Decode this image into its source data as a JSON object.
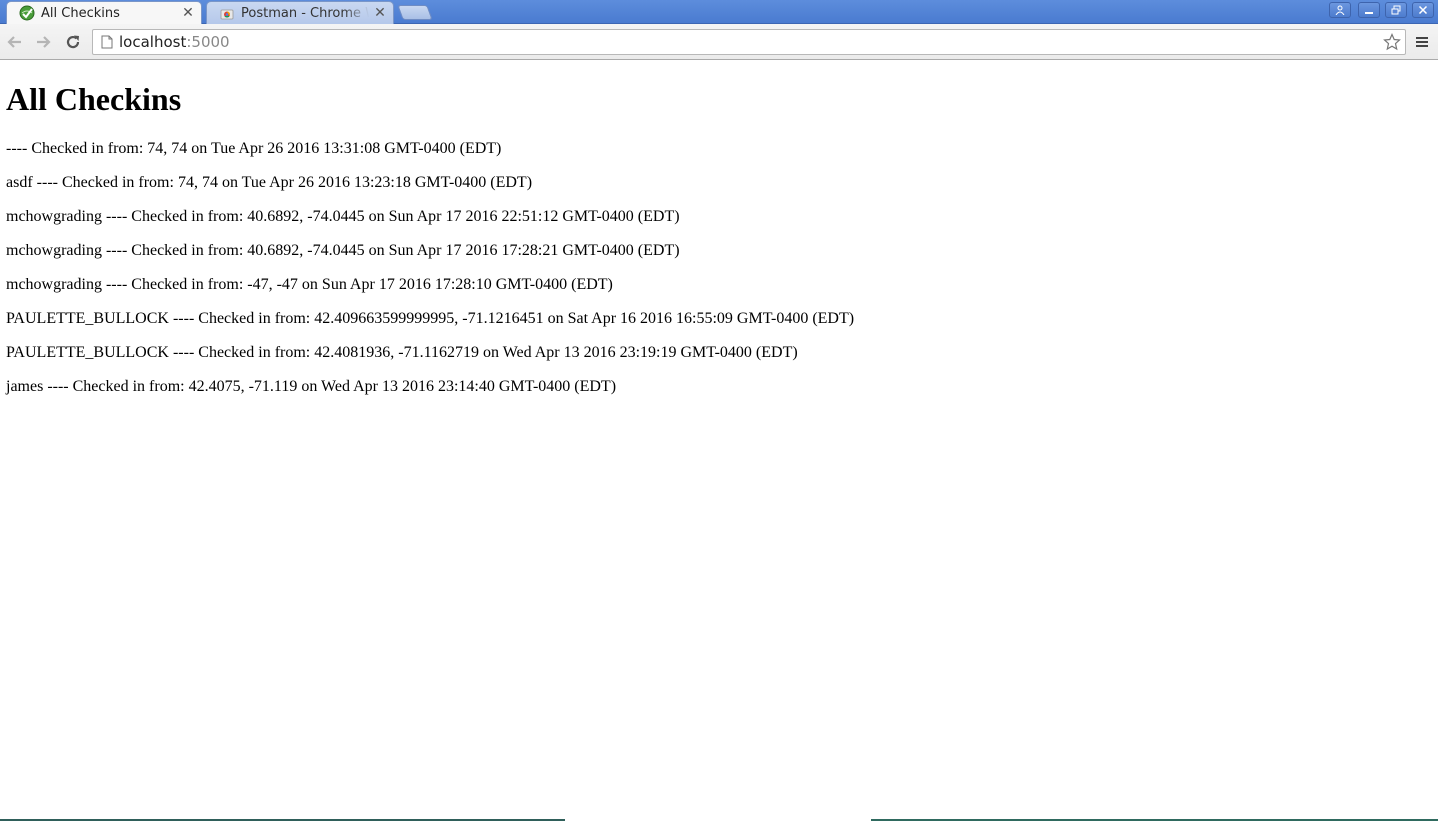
{
  "tabs": [
    {
      "title": "All Checkins",
      "favicon": "globe-checkmark-icon",
      "active": true
    },
    {
      "title": "Postman - Chrome Web Store",
      "favicon": "chrome-webstore-icon",
      "active": false
    }
  ],
  "window_controls": [
    "profile-icon",
    "minimize-icon",
    "restore-icon",
    "close-icon"
  ],
  "toolbar": {
    "url_host": "localhost",
    "url_port": ":5000"
  },
  "page": {
    "title": "All Checkins",
    "checkins": [
      "---- Checked in from: 74, 74 on Tue Apr 26 2016 13:31:08 GMT-0400 (EDT)",
      "asdf ---- Checked in from: 74, 74 on Tue Apr 26 2016 13:23:18 GMT-0400 (EDT)",
      "mchowgrading ---- Checked in from: 40.6892, -74.0445 on Sun Apr 17 2016 22:51:12 GMT-0400 (EDT)",
      "mchowgrading ---- Checked in from: 40.6892, -74.0445 on Sun Apr 17 2016 17:28:21 GMT-0400 (EDT)",
      "mchowgrading ---- Checked in from: -47, -47 on Sun Apr 17 2016 17:28:10 GMT-0400 (EDT)",
      "PAULETTE_BULLOCK ---- Checked in from: 42.409663599999995, -71.1216451 on Sat Apr 16 2016 16:55:09 GMT-0400 (EDT)",
      "PAULETTE_BULLOCK ---- Checked in from: 42.4081936, -71.1162719 on Wed Apr 13 2016 23:19:19 GMT-0400 (EDT)",
      "james ---- Checked in from: 42.4075, -71.119 on Wed Apr 13 2016 23:14:40 GMT-0400 (EDT)"
    ]
  },
  "colors": {
    "tabstrip": "#4a7bd0",
    "toolbar": "#f0f0f0"
  }
}
